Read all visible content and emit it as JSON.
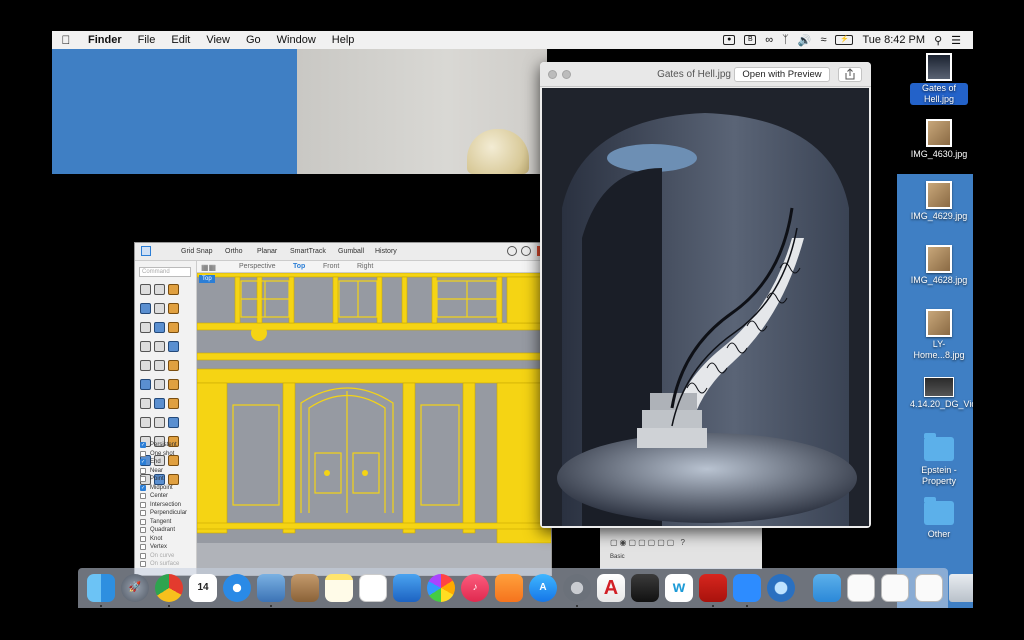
{
  "menubar": {
    "app": "Finder",
    "items": [
      "File",
      "Edit",
      "View",
      "Go",
      "Window",
      "Help"
    ],
    "clock": "Tue 8:42 PM"
  },
  "quicklook": {
    "title": "Gates of Hell.jpg",
    "open_button": "Open with Preview"
  },
  "desktop_icons": [
    {
      "label": "Gates of Hell.jpg",
      "selected": true
    },
    {
      "label": "IMG_4630.jpg"
    },
    {
      "label": "IMG_4629.jpg"
    },
    {
      "label": "IMG_4628.jpg"
    },
    {
      "label": "LY-Home...8.jpg"
    },
    {
      "label": "4.14.20_DG_Video.mp4"
    },
    {
      "label": "Epstein - Property"
    },
    {
      "label": "Other"
    }
  ],
  "cad": {
    "toolbar": [
      "Grid Snap",
      "Ortho",
      "Planar",
      "SmartTrack",
      "Gumball",
      "History"
    ],
    "views": [
      "Perspective",
      "Top",
      "Front",
      "Right"
    ],
    "active_view": "Top",
    "viewport_tag": "Top",
    "command_placeholder": "Command",
    "snaps": [
      {
        "label": "Persistent",
        "checked": true
      },
      {
        "label": "One shot",
        "checked": false
      },
      {
        "label": "End",
        "checked": true
      },
      {
        "label": "Near",
        "checked": false
      },
      {
        "label": "Point",
        "checked": false
      },
      {
        "label": "Midpoint",
        "checked": true
      },
      {
        "label": "Center",
        "checked": false
      },
      {
        "label": "Intersection",
        "checked": false
      },
      {
        "label": "Perpendicular",
        "checked": false
      },
      {
        "label": "Tangent",
        "checked": false
      },
      {
        "label": "Quadrant",
        "checked": false
      },
      {
        "label": "Knot",
        "checked": false
      },
      {
        "label": "Vertex",
        "checked": false
      },
      {
        "label": "On curve",
        "checked": false,
        "dim": true
      },
      {
        "label": "On surface",
        "checked": false,
        "dim": true
      }
    ],
    "panel_label": "Basic"
  },
  "dock": {
    "calendar_day": "14",
    "apps": [
      "finder",
      "launchpad",
      "chrome",
      "calendar",
      "safari",
      "preview",
      "contacts",
      "notes",
      "reminders",
      "keynote",
      "photos",
      "music",
      "books",
      "app-store",
      "system-preferences",
      "autocad",
      "mail-export",
      "webex",
      "acrobat",
      "zoom",
      "quicktime",
      "downloads",
      "window-1",
      "window-2",
      "window-3",
      "trash"
    ]
  },
  "colors": {
    "desktop": "#3f7fc4",
    "accent": "#2b7ed6",
    "cad_lines": "#f5d414"
  }
}
